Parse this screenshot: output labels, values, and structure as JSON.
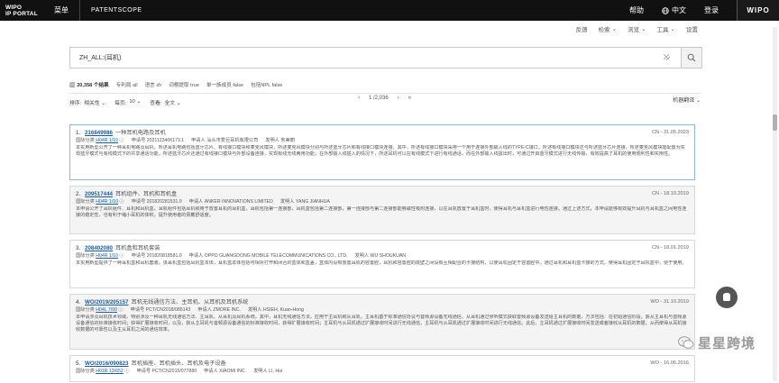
{
  "topbar": {
    "logo_line1": "WIPO",
    "logo_line2": "IP PORTAL",
    "menu": "菜单",
    "product": "PATENTSCOPE",
    "help": "帮助",
    "language": "中文",
    "logout": "登录",
    "brand": "WIPO"
  },
  "subnav": {
    "feedback": "反馈",
    "search": "检索",
    "browse": "浏览",
    "tools": "工具",
    "settings": "设置"
  },
  "search": {
    "query": "ZH_ALL:(耳机)"
  },
  "results_info": {
    "count": "20,358 个结果",
    "office": "专利局 all",
    "language": "语言 zh",
    "stemming": "词根提取 true",
    "single_family": "单一族成员 false",
    "include_npl": "包括NPL false"
  },
  "sortbar": {
    "sort_label": "排序:",
    "sort_value": "相关性",
    "per_page_label": "每页:",
    "per_page_value": "10",
    "view_label": "查看:",
    "view_value": "全文",
    "page_indicator": "1 /2,036",
    "machine_translation": "机器翻译"
  },
  "results": [
    {
      "num": "1.",
      "pubno": "216849986",
      "title": "一种耳机电路及耳机",
      "date": "CN - 31.05.2023",
      "ipc_label": "国际分类",
      "ipc": "H04R 1/10",
      "app_label": "申请号",
      "app_no": "2021123406173.1",
      "applicant_label": "申请人",
      "applicant": "汕头市爱巨耳机有限公司",
      "inventor_label": "发明人",
      "inventor": "朱美丽",
      "abstract": "本实用新型公开了一种耳机电路及耳机，所述耳机电路包括蓝牙芯片、有线接口模块和麦克风模块，所述麦克风模块分别与所述蓝牙芯片和有线接口模块连接，其中，所述有线接口模块采用一个用于连接外部输入线的TYPE-C接口，所述有线接口模块还与所述蓝牙芯片连接，所述麦克风模块能配置为实现蓝牙模式与有线模式下的共享通话功能，所述蓝牙芯片还通过有线接口模块与外部设备连接，实现有线无线两用功能；在外部输入线插入的情况下，所述耳机可以在有线模式下进行有线通话，而在外部输入线拔出时，可通过开启蓝牙模式进行无线传输，有效提高了耳机的使用便利性和实用性。"
    },
    {
      "num": "2.",
      "pubno": "209517444",
      "title": "耳机组件、耳机和耳机盒",
      "date": "CN - 18.10.2019",
      "ipc_label": "国际分类",
      "ipc": "H04R 1/10",
      "app_label": "申请号",
      "app_no": "201820281531.0",
      "applicant_label": "申请人",
      "applicant": "ANKER INNOVATIONS LIMITED",
      "inventor_label": "发明人",
      "inventor": "YANG JIANHUA",
      "abstract": "本申请公开了耳机组件、耳机和耳机盒。耳机组件包括耳机和用于放置耳机的耳机盒，耳机包括第一连接部，耳机盒包括第二连接部，第一连接部与第二连接部能够磁性吸附连接，以在耳机放置于耳机盒时，使得耳机与耳机盒进行电性连接。通过上述方式，本申请能够有效提升耳机与耳机盒之间电性连接的稳定性，也有利于缩小耳机的体积，提升使用者的佩戴舒适度。"
    },
    {
      "num": "3.",
      "pubno": "208402080",
      "title": "耳机盒和耳机套装",
      "date": "CN - 18.01.2019",
      "ipc_label": "国际分类",
      "ipc": "H04R 1/10",
      "app_label": "申请号",
      "app_no": "201820818581.0",
      "applicant_label": "申请人",
      "applicant": "OPPO GUANGDONG MOBILE TELECOMMUNICATIONS CO., LTD.",
      "inventor_label": "发明人",
      "inventor": "WU SHOUKUAN",
      "abstract": "本实用新型提供了一种耳机盒和耳机套装。该耳机盒包括耳机盒本体，耳机盒本体包括可相对打开和闭合的盒体和盒盖，盒体内设有放置耳机的容置腔，耳机和容置腔的底壁之间设有互相配合的卡接结构，以使耳机固定于容置腔中。通过耳机和耳机盒卡接的方式，使得耳机固定于耳机盒中，便于使用。"
    },
    {
      "num": "4.",
      "pubno": "WO/2019/205157",
      "title": "耳机无线通信方法、主耳机、从耳机及耳机系统",
      "date": "WO - 31.10.2019",
      "ipc_label": "国际分类",
      "ipc": "H04L 7/00",
      "app_label": "申请号",
      "app_no": "PCT/CN2018/085143",
      "applicant_label": "申请人",
      "applicant": "ZMORE INC.",
      "inventor_label": "发明人",
      "inventor": "HSIEH, Kuan-Hong",
      "abstract": "本申请涉及耳机技术领域，特别涉及一种耳机无线通信方法、主耳机、从耳机及耳机系统。其中，耳机无线通信方法，应用于主耳机和从耳机，主耳机基于标准通信协议与音频源设备无线通信，从耳机通过侦听模式获取音频源设备发送给主耳机的数据，方法包括：在初始通信阶段，获从主耳机与音频源设备通信的标准接收时间；获得扩展接收时间，以及，获从主耳机与音频源设备通信的标准接收时间，获得扩展接收时间；主耳机与从耳机通过扩展接收时间进行无线通信，主耳机与从耳机通过扩展接收时间进行无线通信。此后，主耳机通过扩展接收时间发送或者接收从耳机的数据，从而使得从耳机接收数据的可靠性以及主从耳机之间的通信效率。"
    },
    {
      "num": "5.",
      "pubno": "WO/2016/090823",
      "title": "耳机插座、耳机插头、耳机及电子设备",
      "date": "WO - 16.06.2016",
      "ipc_label": "国际分类",
      "ipc": "H01R 13/652",
      "app_label": "申请号",
      "app_no": "PCT/CN2015/077880",
      "applicant_label": "申请人",
      "applicant": "XIAOMI INC.",
      "inventor_label": "发明人",
      "inventor": "LI, Hui",
      "abstract": ""
    }
  ],
  "watermark": {
    "text": "星星跨境"
  }
}
